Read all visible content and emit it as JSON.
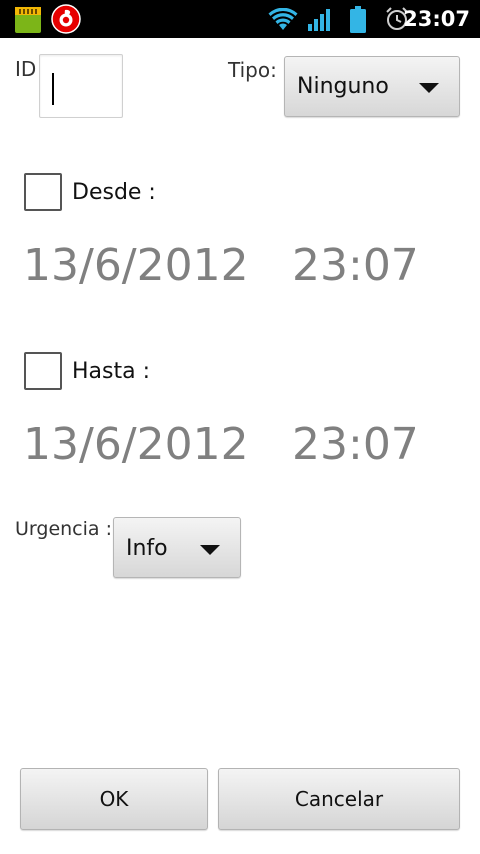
{
  "status_bar": {
    "time": "23:07",
    "icons": [
      "sd-card-icon",
      "vodafone-icon",
      "wifi-icon",
      "signal-icon",
      "battery-icon",
      "alarm-icon"
    ]
  },
  "form": {
    "id_label": "ID",
    "id_value": "",
    "tipo_label": "Tipo:",
    "tipo_value": "Ninguno",
    "desde_label": "Desde :",
    "desde_checked": false,
    "desde_date": "13/6/2012",
    "desde_time": "23:07",
    "hasta_label": "Hasta :",
    "hasta_checked": false,
    "hasta_date": "13/6/2012",
    "hasta_time": "23:07",
    "urgencia_label": "Urgencia :",
    "urgencia_value": "Info"
  },
  "buttons": {
    "ok_label": "OK",
    "cancel_label": "Cancelar"
  },
  "colors": {
    "status_bar_bg": "#000000",
    "accent_blue": "#33b5e5",
    "muted_value": "#808080"
  }
}
